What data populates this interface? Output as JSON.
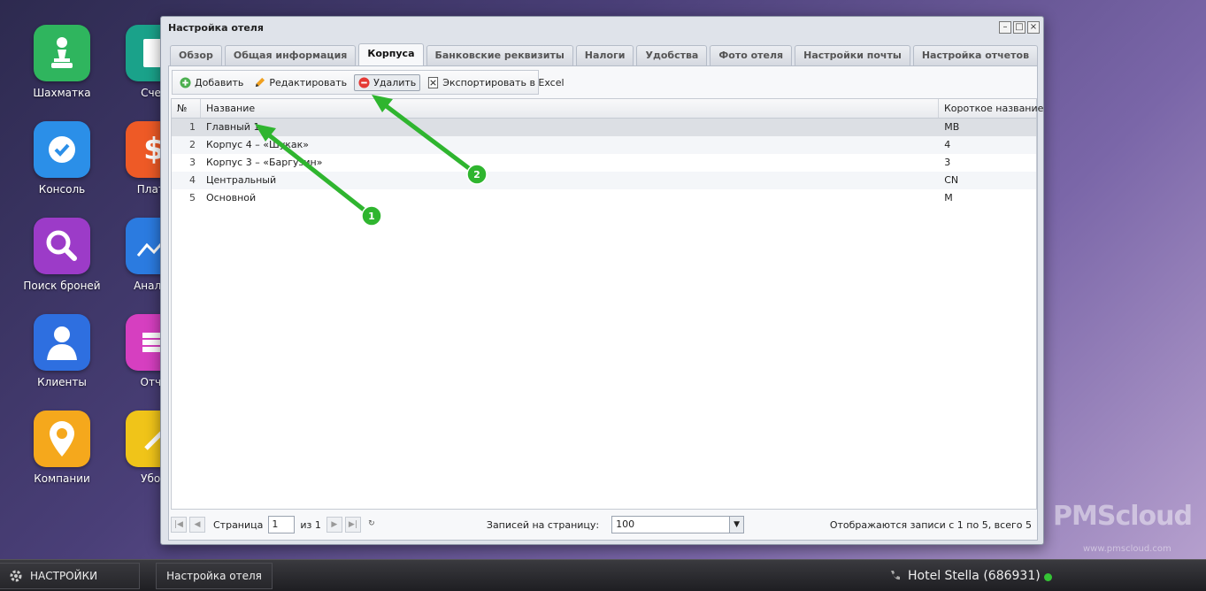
{
  "desktop": {
    "icons": [
      {
        "label": "Шахматка",
        "color": "#2fb55e"
      },
      {
        "label": "Консоль",
        "color": "#2b8fe8"
      },
      {
        "label": "Поиск броней",
        "color": "#9c3bc8"
      },
      {
        "label": "Клиенты",
        "color": "#2e6fe0"
      },
      {
        "label": "Компании",
        "color": "#f5a81c"
      }
    ],
    "icons_col2": [
      {
        "label": "Счет",
        "color": "#1aa28a"
      },
      {
        "label": "Плате",
        "color": "#ee5a26"
      },
      {
        "label": "Аналит",
        "color": "#2b7be0"
      },
      {
        "label": "Отче",
        "color": "#d63fc0"
      },
      {
        "label": "Убор",
        "color": "#f0c419"
      }
    ]
  },
  "window": {
    "title": "Настройка отеля",
    "controls": [
      "–",
      "□",
      "×"
    ]
  },
  "tabs": [
    {
      "label": "Обзор"
    },
    {
      "label": "Общая информация"
    },
    {
      "label": "Корпуса"
    },
    {
      "label": "Банковские реквизиты"
    },
    {
      "label": "Налоги"
    },
    {
      "label": "Удобства"
    },
    {
      "label": "Фото отеля"
    },
    {
      "label": "Настройки почты"
    },
    {
      "label": "Настройка отчетов"
    }
  ],
  "toolbar": {
    "add": "Добавить",
    "edit": "Редактировать",
    "delete": "Удалить",
    "export": "Экспортировать в Excel"
  },
  "grid": {
    "columns": {
      "num": "№",
      "name": "Название",
      "short": "Короткое название"
    },
    "rows": [
      {
        "num": "1",
        "name": "Главный 1",
        "short": "MB"
      },
      {
        "num": "2",
        "name": "Корпус 4 – «Шукак»",
        "short": "4"
      },
      {
        "num": "3",
        "name": "Корпус 3 – «Баргузин»",
        "short": "3"
      },
      {
        "num": "4",
        "name": "Центральный",
        "short": "CN"
      },
      {
        "num": "5",
        "name": "Основной",
        "short": "M"
      }
    ]
  },
  "pager": {
    "page_label": "Страница",
    "page_value": "1",
    "of_label": "из 1",
    "per_page_label": "Записей на страницу:",
    "per_page_value": "100",
    "summary": "Отображаются записи с 1 по 5, всего 5"
  },
  "annotations": {
    "marker1": "1",
    "marker2": "2",
    "color": "#2fb52f"
  },
  "logo": {
    "text": "PMScloud",
    "url": "www.pmscloud.com"
  },
  "taskbar": {
    "settings_label": "НАСТРОЙКИ",
    "task_label": "Настройка отеля",
    "hotel": "Hotel Stella (686931)",
    "status_color": "#35c435"
  }
}
